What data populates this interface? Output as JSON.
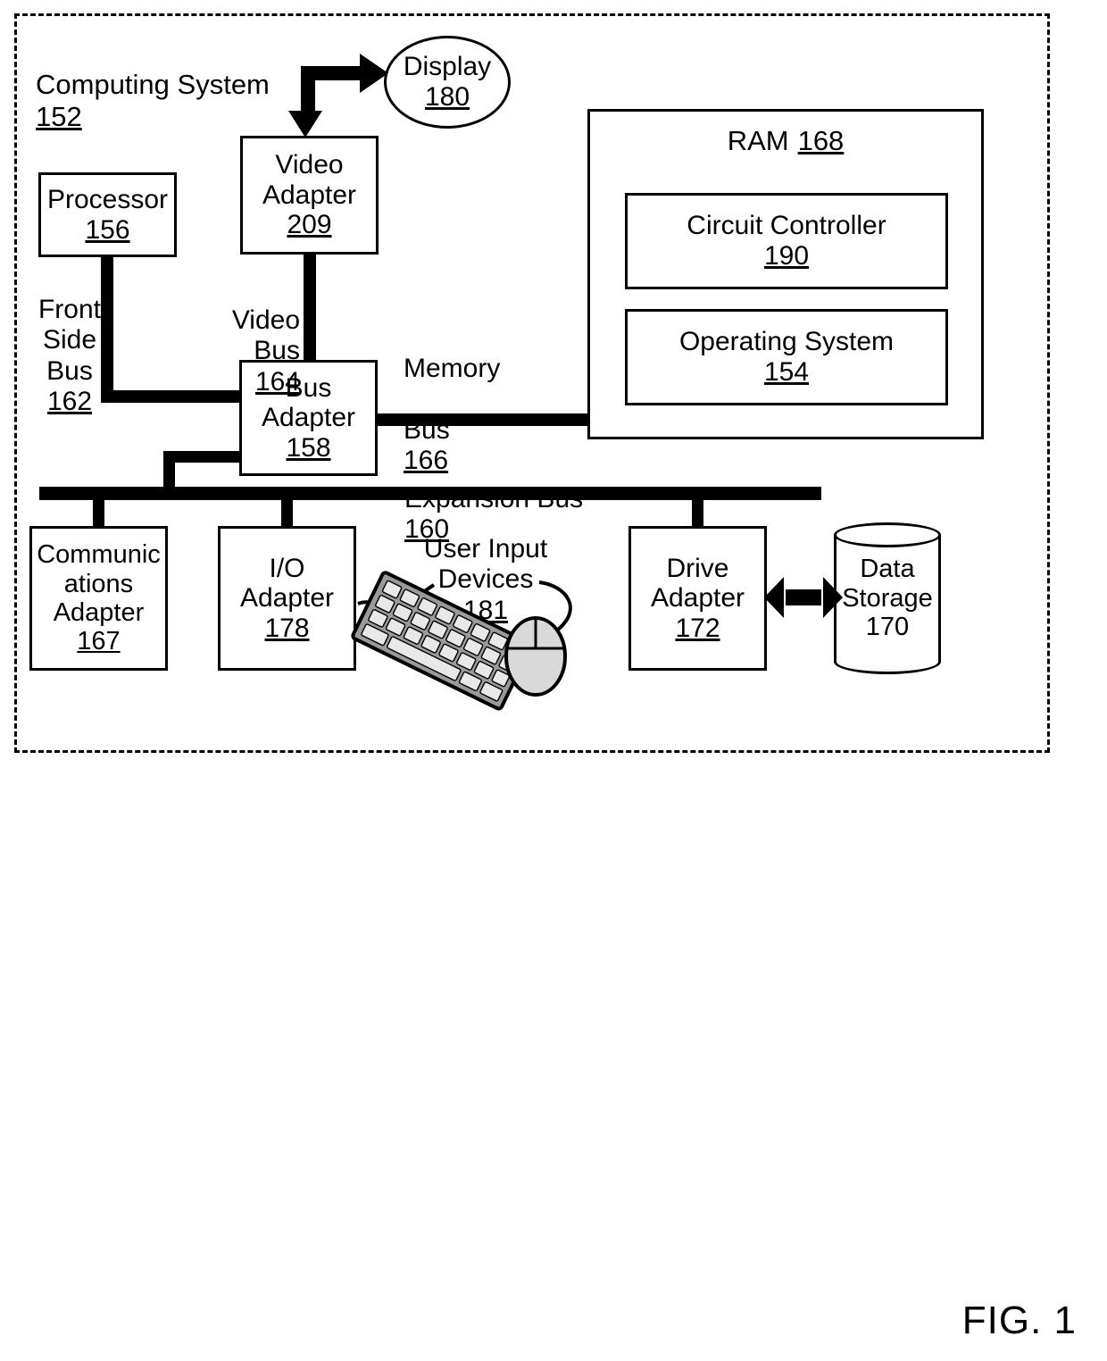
{
  "figure": {
    "caption": "FIG. 1"
  },
  "system": {
    "title": "Computing System",
    "ref": "152"
  },
  "nodes": {
    "processor": {
      "title": "Processor",
      "ref": "156"
    },
    "video_adapter": {
      "title": "Video\nAdapter",
      "ref": "209"
    },
    "display": {
      "title": "Display",
      "ref": "180"
    },
    "bus_adapter": {
      "title": "Bus\nAdapter",
      "ref": "158"
    },
    "ram": {
      "title": "RAM",
      "ref": "168"
    },
    "circuit_controller": {
      "title": "Circuit Controller",
      "ref": "190"
    },
    "operating_system": {
      "title": "Operating System",
      "ref": "154"
    },
    "communications_adapter": {
      "title": "Communic\nations\nAdapter",
      "ref": "167"
    },
    "io_adapter": {
      "title": "I/O\nAdapter",
      "ref": "178"
    },
    "drive_adapter": {
      "title": "Drive\nAdapter",
      "ref": "172"
    },
    "data_storage": {
      "title": "Data\nStorage",
      "ref": "170"
    }
  },
  "buses": {
    "front_side_bus": {
      "title": "Front\nSide\nBus",
      "ref": "162"
    },
    "video_bus": {
      "title": "Video Bus",
      "ref": "164"
    },
    "memory_bus": {
      "title": "Memory\nBus",
      "ref": "166"
    },
    "expansion_bus": {
      "title": "Expansion Bus",
      "ref": "160"
    }
  },
  "peripherals": {
    "user_input_devices": {
      "title": "User Input\nDevices",
      "ref": "181"
    }
  },
  "colors": {
    "ink": "#000000",
    "paper": "#ffffff"
  }
}
